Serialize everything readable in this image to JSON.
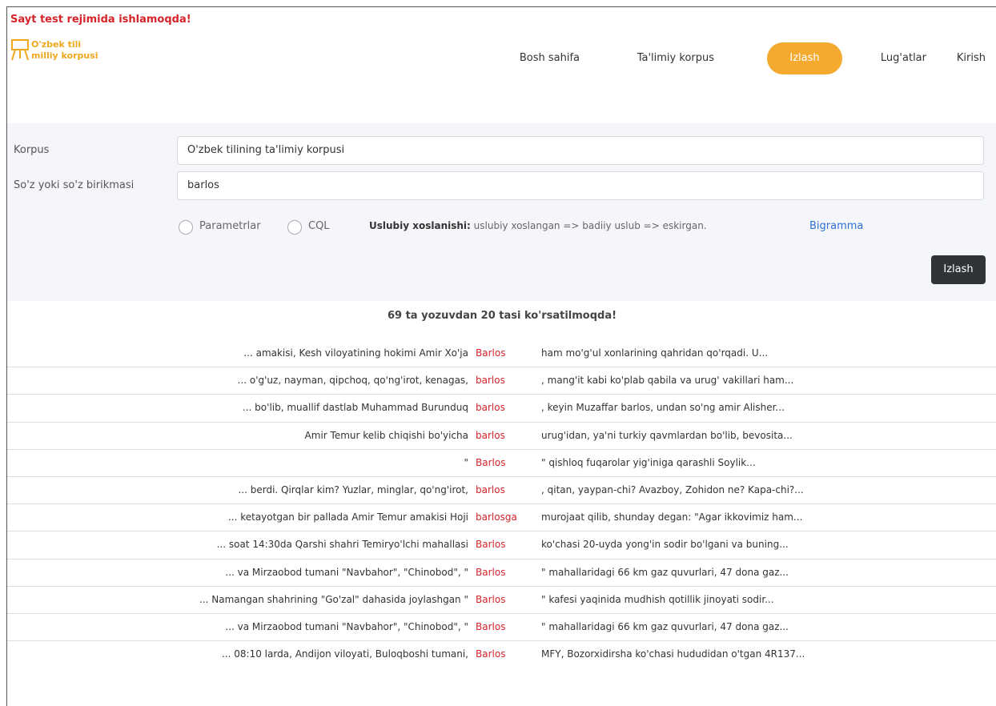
{
  "warning": "Sayt test rejimida ishlamoqda!",
  "logo": {
    "text": "O'zbek tili\nmilliy korpusi",
    "icon": "easel-icon",
    "color": "#f0a81c"
  },
  "nav": {
    "items": [
      "Bosh sahifa",
      "Ta'limiy korpus",
      "Izlash",
      "Lug'atlar",
      "Kirish"
    ],
    "active": "Izlash",
    "active_color": "#f3aa2f"
  },
  "search": {
    "corpus_label": "Korpus",
    "corpus_value": "O'zbek tilining ta'limiy korpusi",
    "word_label": "So'z yoki so'z birikmasi",
    "word_value": "barlos",
    "radio_params": "Parametrlar",
    "radio_cql": "CQL",
    "style_label": "Uslubiy xoslanishi:",
    "style_value": "uslubiy xoslangan => badiiy uslub => eskirgan.",
    "bigram_link": "Bigramma",
    "button": "Izlash"
  },
  "results": {
    "summary": "69 ta yozuvdan 20 tasi ko'rsatilmoqda!",
    "rows": [
      {
        "left": "... amakisi, Kesh viloyatining hokimi Amir Xo'ja",
        "key": "Barlos",
        "right": "ham mo'g'ul xonlarining qahridan qo'rqadi. U..."
      },
      {
        "left": "... o'g'uz, nayman, qipchoq, qo'ng'irot, kenagas,",
        "key": "barlos",
        "right": ", mang'it kabi ko'plab qabila va urug' vakillari ham..."
      },
      {
        "left": "... bo'lib, muallif dastlab Muhammad Burunduq",
        "key": "barlos",
        "right": ", keyin Muzaffar barlos, undan so'ng amir Alisher..."
      },
      {
        "left": "Amir Temur kelib chiqishi bo'yicha",
        "key": "barlos",
        "right": "urug'idan, ya'ni turkiy qavmlardan bo'lib, bevosita..."
      },
      {
        "left": "\"",
        "key": "Barlos",
        "right": "\" qishloq fuqarolar yig'iniga qarashli Soylik..."
      },
      {
        "left": "... berdi. Qirqlar kim? Yuzlar, minglar, qo'ng'irot,",
        "key": "barlos",
        "right": ", qitan, yaypan-chi? Avazboy, Zohidon ne? Kapa-chi?..."
      },
      {
        "left": "... ketayotgan bir pallada Amir Temur amakisi Hoji",
        "key": "barlosga",
        "right": "murojaat qilib, shunday degan: \"Agar ikkovimiz ham..."
      },
      {
        "left": "... soat 14:30da Qarshi shahri Temiryo'lchi mahallasi",
        "key": "Barlos",
        "right": "ko'chasi 20-uyda yong'in sodir bo'lgani va buning..."
      },
      {
        "left": "... va Mirzaobod tumani \"Navbahor\", \"Chinobod\", \"",
        "key": "Barlos",
        "right": "\" mahallaridagi 66 km gaz quvurlari, 47 dona gaz..."
      },
      {
        "left": "... Namangan shahrining \"Go'zal\" dahasida joylashgan \"",
        "key": "Barlos",
        "right": "\" kafesi yaqinida mudhish qotillik jinoyati sodir..."
      },
      {
        "left": "... va Mirzaobod tumani \"Navbahor\", \"Chinobod\", \"",
        "key": "Barlos",
        "right": "\" mahallaridagi 66 km gaz quvurlari, 47 dona gaz..."
      },
      {
        "left": "... 08:10 larda, Andijon viloyati, Buloqboshi tumani,",
        "key": "Barlos",
        "right": "MFY, Bozorxidirsha ko'chasi hududidan o'tgan 4R137..."
      }
    ]
  }
}
